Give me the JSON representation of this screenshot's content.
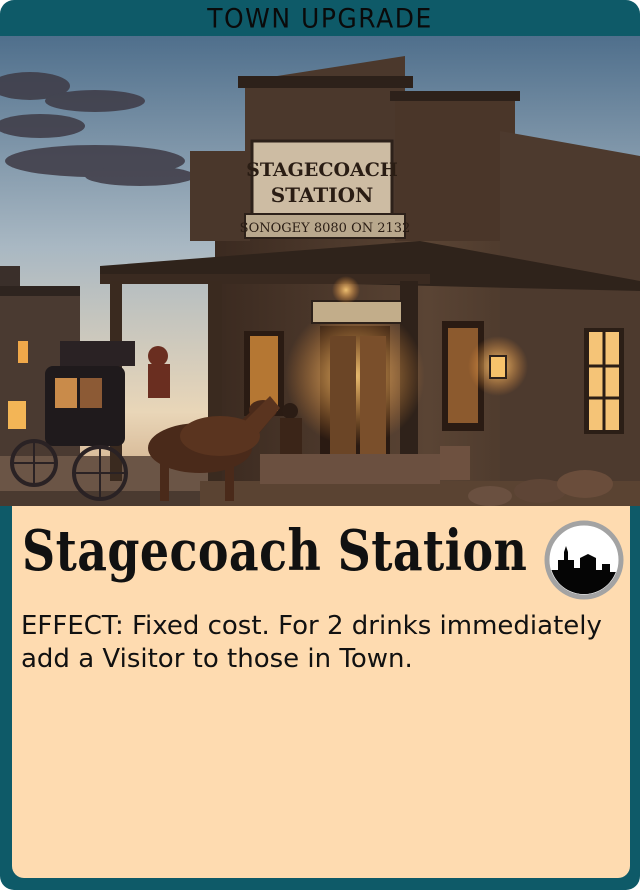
{
  "card": {
    "type_label": "TOWN UPGRADE",
    "name": "Stagecoach Station",
    "effect_text": "EFFECT: Fixed cost. For 2 drinks immediately add a Visitor to those in Town.",
    "icon": "town-skyline-icon",
    "illustration": {
      "sign_main": "STAGECOACH STATION",
      "sign_sub": "SONOGEY 8080 ON  2132"
    }
  },
  "colors": {
    "frame": "#0e5a68",
    "panel": "#fedbb0",
    "text": "#111111",
    "icon_ring": "#a3a3a3"
  }
}
